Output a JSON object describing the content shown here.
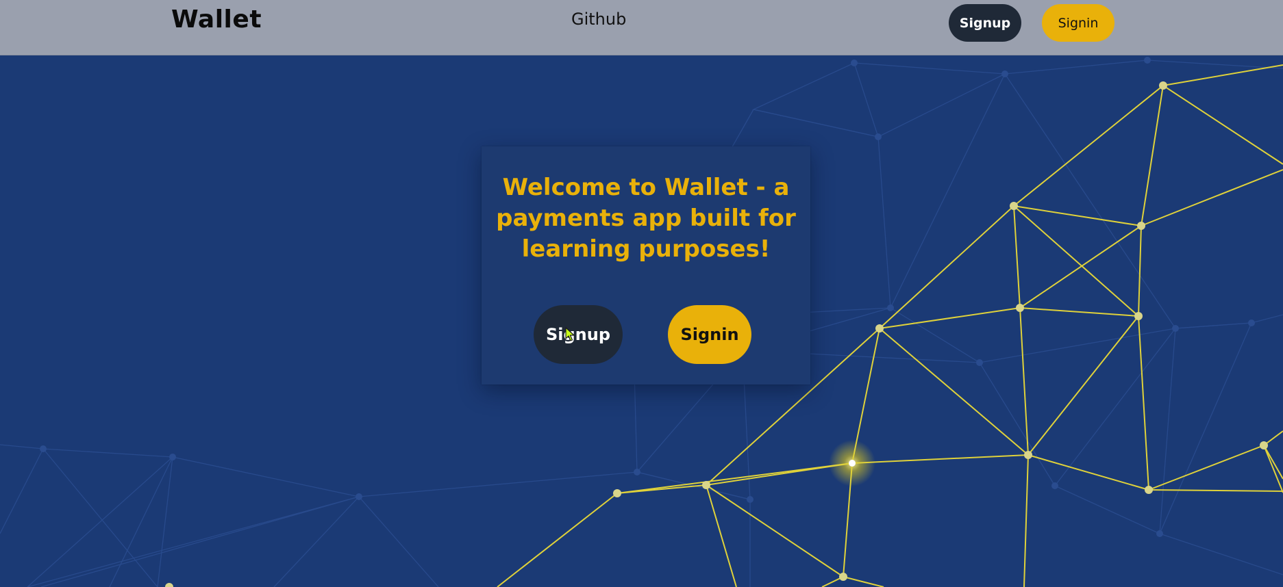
{
  "navbar": {
    "brand": "Wallet",
    "github_link": "Github",
    "signup_label": "Signup",
    "signin_label": "Signin"
  },
  "hero": {
    "title": "Welcome to Wallet - a payments app built for learning purposes!",
    "signup_label": "Signup",
    "signin_label": "Signin"
  },
  "colors": {
    "navbar_bg": "#9aa0ae",
    "hero_bg": "#1b3a75",
    "accent_yellow": "#e9b10a",
    "dark_button": "#1f2937",
    "network_line": "#e0d23a",
    "network_node": "#d9d58a"
  },
  "icons": {
    "cursor": "mouse-pointer-icon"
  }
}
